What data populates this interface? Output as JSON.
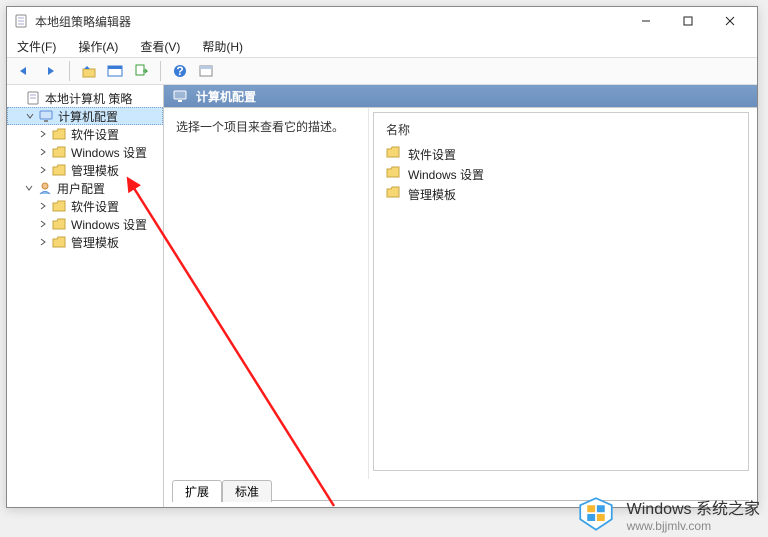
{
  "window": {
    "title": "本地组策略编辑器"
  },
  "menu": {
    "file": "文件(F)",
    "action": "操作(A)",
    "view": "查看(V)",
    "help": "帮助(H)"
  },
  "tree": {
    "root": "本地计算机 策略",
    "computer": "计算机配置",
    "comp_software": "软件设置",
    "comp_windows": "Windows 设置",
    "comp_templates": "管理模板",
    "user": "用户配置",
    "user_software": "软件设置",
    "user_windows": "Windows 设置",
    "user_templates": "管理模板"
  },
  "content": {
    "header": "计算机配置",
    "description": "选择一个项目来查看它的描述。",
    "list_header": "名称",
    "items": {
      "software": "软件设置",
      "windows": "Windows 设置",
      "templates": "管理模板"
    }
  },
  "tabs": {
    "extended": "扩展",
    "standard": "标准"
  },
  "watermark": {
    "title": "Windows 系统之家",
    "url": "www.bjjmlv.com"
  }
}
